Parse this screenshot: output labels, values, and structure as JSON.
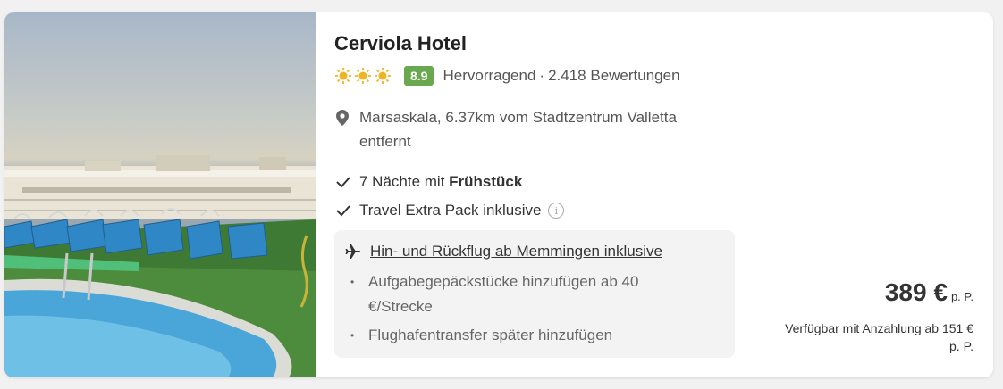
{
  "hotel": {
    "name": "Cerviola Hotel",
    "sun_rating": 3,
    "sun_icon": "sun-icon",
    "score": "8.9",
    "score_color": "#6aa84f",
    "rating_label": "Hervorragend",
    "separator": "·",
    "reviews": "2.418 Bewertungen",
    "location": "Marsaskala, 6.37km vom Stadtzentrum Valletta entfernt",
    "location_icon": "map-pin-icon"
  },
  "features": [
    {
      "icon": "checkmark-icon",
      "prefix": "7 Nächte mit ",
      "bold": "Frühstück"
    },
    {
      "icon": "checkmark-icon",
      "prefix": "Travel Extra Pack inklusive",
      "info_icon": "info-icon",
      "info_glyph": "i"
    }
  ],
  "flight": {
    "icon": "airplane-icon",
    "headline": "Hin- und Rückflug ab Memmingen inklusive",
    "bullet_glyph": "•",
    "bullets": [
      "Aufgabegepäckstücke hinzufügen ab 40 €/Strecke",
      "Flughafentransfer später hinzufügen"
    ]
  },
  "price": {
    "amount": "389 €",
    "unit": "p. P.",
    "deposit": "Verfügbar mit Anzahlung ab 151 € p. P."
  }
}
